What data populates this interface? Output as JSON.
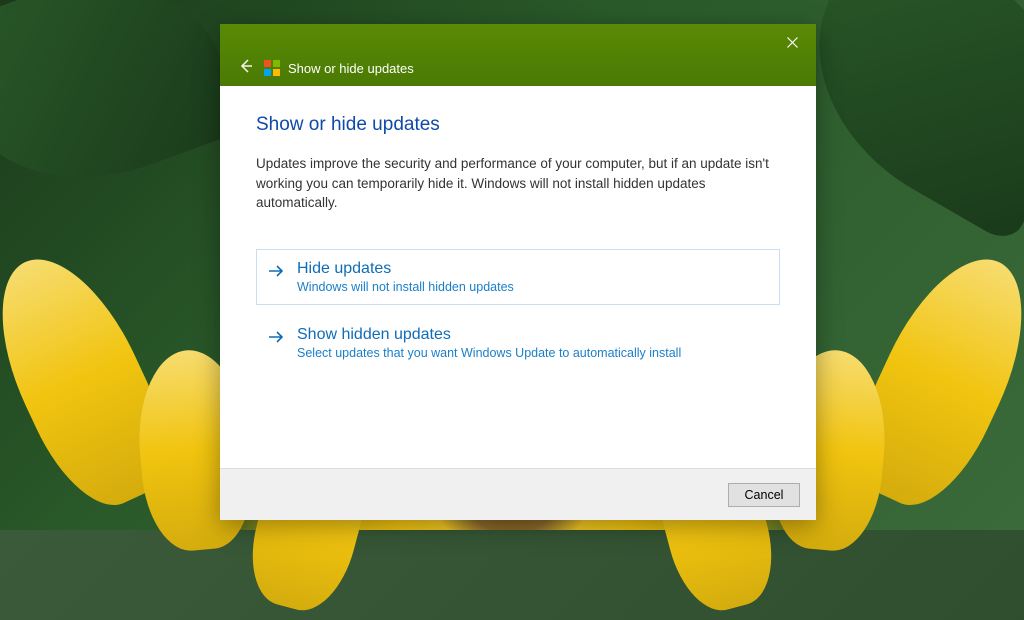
{
  "window": {
    "title": "Show or hide updates"
  },
  "page": {
    "heading": "Show or hide updates",
    "description": "Updates improve the security and performance of your computer, but if an update isn't working you can temporarily hide it. Windows will not install hidden updates automatically."
  },
  "options": [
    {
      "title": "Hide updates",
      "desc": "Windows will not install hidden updates"
    },
    {
      "title": "Show hidden updates",
      "desc": "Select updates that you want Windows Update to automatically install"
    }
  ],
  "footer": {
    "cancel": "Cancel"
  }
}
